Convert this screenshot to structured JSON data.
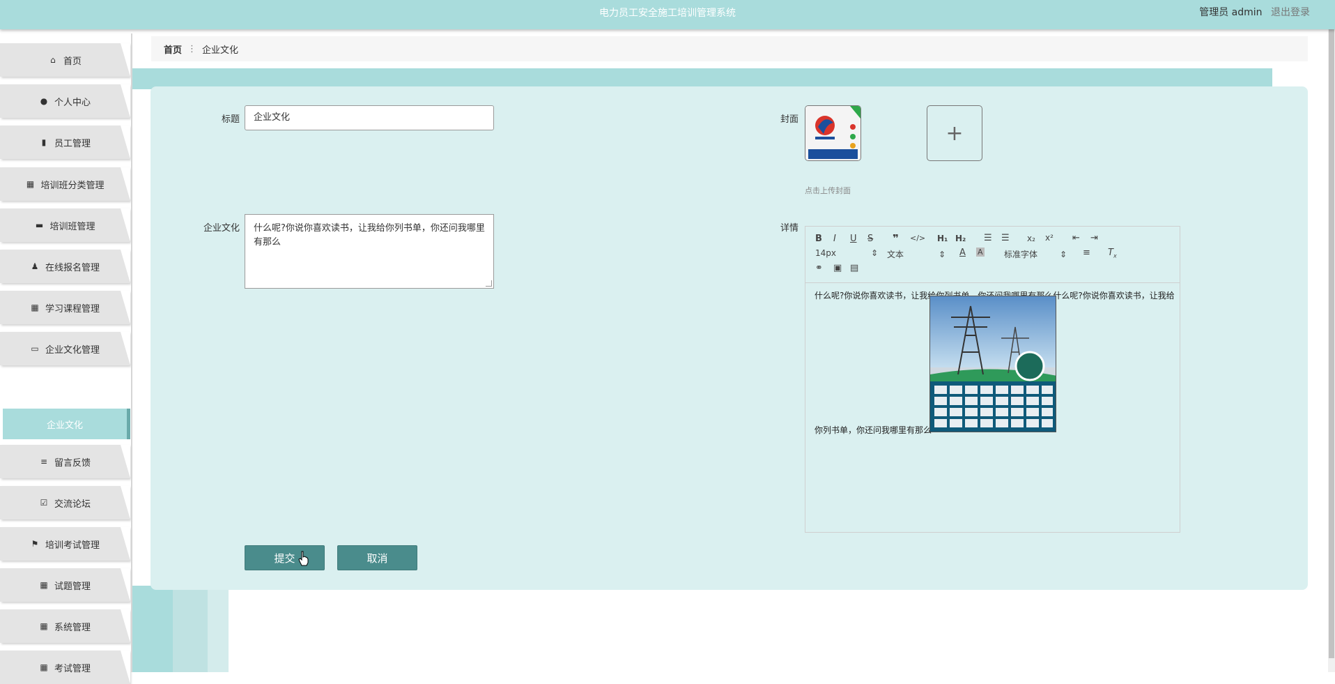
{
  "header": {
    "app_title": "电力员工安全施工培训管理系统",
    "user_label": "管理员 admin",
    "logout_label": "退出登录"
  },
  "sidebar": {
    "items": [
      {
        "label": "首页",
        "icon": "home-icon"
      },
      {
        "label": "个人中心",
        "icon": "user-icon"
      },
      {
        "label": "员工管理",
        "icon": "bar-chart-icon"
      },
      {
        "label": "培训班分类管理",
        "icon": "grid-icon"
      },
      {
        "label": "培训班管理",
        "icon": "comment-icon"
      },
      {
        "label": "在线报名管理",
        "icon": "person-icon"
      },
      {
        "label": "学习课程管理",
        "icon": "grid-icon"
      },
      {
        "label": "企业文化管理",
        "icon": "monitor-icon"
      },
      {
        "label": "留言反馈",
        "icon": "list-icon"
      },
      {
        "label": "交流论坛",
        "icon": "clipboard-check-icon"
      },
      {
        "label": "培训考试管理",
        "icon": "flag-icon"
      },
      {
        "label": "试题管理",
        "icon": "grid-icon"
      },
      {
        "label": "系统管理",
        "icon": "grid-icon"
      },
      {
        "label": "考试管理",
        "icon": "grid-icon"
      }
    ],
    "active_sub": "企业文化"
  },
  "breadcrumb": {
    "home": "首页",
    "current": "企业文化"
  },
  "form": {
    "title_label": "标题",
    "title_value": "企业文化",
    "culture_label": "企业文化",
    "culture_value": "什么呢?你说你喜欢读书，让我给你列书单，你还问我哪里有那么",
    "cover_label": "封面",
    "cover_hint": "点击上传封面",
    "detail_label": "详情",
    "detail_line1": "什么呢?你说你喜欢读书，让我给你列书单，你还问我哪里有那么什么呢?你说你喜欢读书，让我给",
    "detail_line2": "你列书单，你还问我哪里有那么",
    "submit_label": "提交",
    "cancel_label": "取消"
  },
  "editor_toolbar": {
    "font_size": "14px",
    "block_type": "文本",
    "font_family": "标准字体"
  },
  "colors": {
    "accent": "#a9dcdc",
    "panel": "#daf0f0",
    "button": "#4a8c8c"
  }
}
